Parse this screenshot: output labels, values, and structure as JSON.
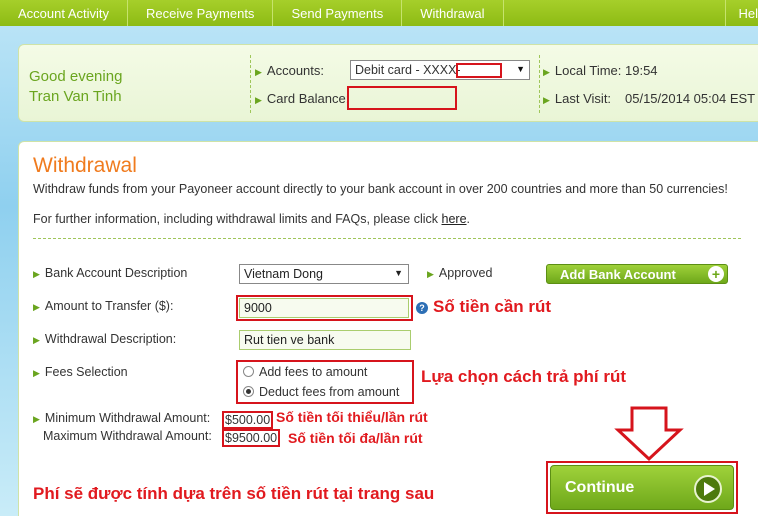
{
  "nav": {
    "items": [
      "Account Activity",
      "Receive Payments",
      "Send Payments",
      "Withdrawal"
    ],
    "help": "Hel"
  },
  "header": {
    "greeting_line1": "Good evening",
    "greeting_line2": "Tran Van Tinh",
    "accounts_label": "Accounts:",
    "accounts_value": "Debit card - XXXX-",
    "card_balance_label": "Card Balance:",
    "local_time_label": "Local Time:",
    "local_time_value": "19:54",
    "last_visit_label": "Last Visit:",
    "last_visit_value": "05/15/2014 05:04 EST"
  },
  "main": {
    "title": "Withdrawal",
    "description": "Withdraw funds from your Payoneer account directly to your bank account in over 200 countries and more than 50 currencies!",
    "more_info_prefix": "For further information, including withdrawal limits and FAQs, please click ",
    "more_info_link": "here",
    "more_info_suffix": "."
  },
  "form": {
    "bank_label": "Bank Account Description",
    "bank_value": "Vietnam Dong",
    "approved": "Approved",
    "add_bank_button": "Add Bank Account",
    "amount_label": "Amount to Transfer ($):",
    "amount_value": "9000",
    "desc_label": "Withdrawal Description:",
    "desc_value": "Rut tien ve bank",
    "fees_label": "Fees Selection",
    "fee_option_1": "Add fees to amount",
    "fee_option_2": "Deduct fees from amount",
    "min_label": "Minimum Withdrawal Amount:",
    "min_value": "$500.00",
    "max_label": "Maximum Withdrawal Amount:",
    "max_value": "$9500.00",
    "continue_button": "Continue"
  },
  "annotations": {
    "amount_note": "Số tiền cần rút",
    "fees_note": "Lựa chọn cách trả phí rút",
    "min_note": "Số tiền tối thiểu/lần rút",
    "max_note": "Số tiền tối đa/lần rút",
    "bottom_note": "Phí sẽ được tính dựa trên số tiền rút tại trang sau"
  },
  "colors": {
    "nav_green": "#8dbb14",
    "accent_orange": "#f07b1e",
    "annotation_red": "#e11a1f"
  }
}
